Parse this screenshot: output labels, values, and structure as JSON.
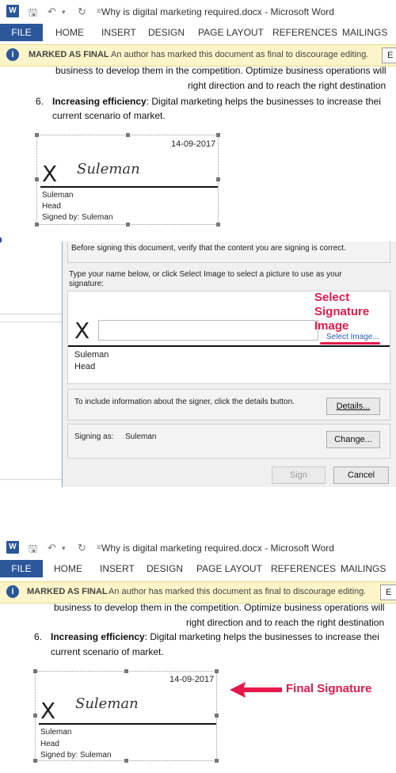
{
  "panels": [
    {
      "app_icon": "W",
      "window_title": "Why is digital marketing required.docx - Microsoft Word",
      "ribbon_tabs": [
        "FILE",
        "HOME",
        "INSERT",
        "DESIGN",
        "PAGE LAYOUT",
        "REFERENCES",
        "MAILINGS"
      ],
      "infobar_title": "MARKED AS FINAL",
      "infobar_message": "An author has marked this document as final to discourage editing.",
      "infobar_button": "E",
      "doc_line1": "business to develop them in the competition. Optimize business operations will",
      "doc_line2": "right direction and to reach the right destination",
      "list_number": "6.",
      "list_bold": "Increasing efficiency",
      "list_text": ": Digital marketing helps the businesses to increase thei",
      "list_text2": "current scenario of market.",
      "signature": {
        "date": "14-09-2017",
        "x_mark": "X",
        "name": "Suleman",
        "title": "Head",
        "signed_by": "Signed by: Suleman"
      }
    },
    {
      "app_icon": "W",
      "window_title": "Why is digital marketing required.docx - Microsoft Word",
      "ribbon_tabs": [
        "FILE",
        "HOME",
        "INSERT",
        "DESIGN",
        "PAGE LAYOUT",
        "REFERENCES",
        "MAILINGS"
      ],
      "infobar_title": "MARKED AS FINAL",
      "infobar_message": "An author has marked this document as final to discourage editing.",
      "infobar_button": "E",
      "doc_line1": "business to develop them in the competition. Optimize business operations will",
      "doc_line2": "right direction and to reach the right destination",
      "list_number": "6.",
      "list_bold": "Increasing efficiency",
      "list_text": ": Digital marketing helps the businesses to increase thei",
      "list_text2": "current scenario of market.",
      "signature": {
        "date": "14-09-2017",
        "x_mark": "X",
        "name": "Suleman",
        "title": "Head",
        "signed_by": "Signed by: Suleman"
      }
    }
  ],
  "dialog": {
    "verify_text": "Before signing this document, verify that the content you are signing is correct.",
    "instruction": "Type your name below, or click Select Image to select a picture to use as your signature:",
    "x_mark": "X",
    "name_input_value": "",
    "select_image_link": "Select Image...",
    "signer_name": "Suleman",
    "signer_title": "Head",
    "details_text": "To include information about the signer, click the details button.",
    "details_button": "Details...",
    "signing_as_label": "Signing as:",
    "signing_as_value": "Suleman",
    "change_button": "Change...",
    "sign_button": "Sign",
    "cancel_button": "Cancel"
  },
  "annotations": {
    "select_signature": "Select Signature Image",
    "final_signature": "Final Signature"
  },
  "colors": {
    "word_blue": "#2b579a",
    "annotation_red": "#e5194a",
    "infobar_yellow": "#fdf5c9"
  }
}
